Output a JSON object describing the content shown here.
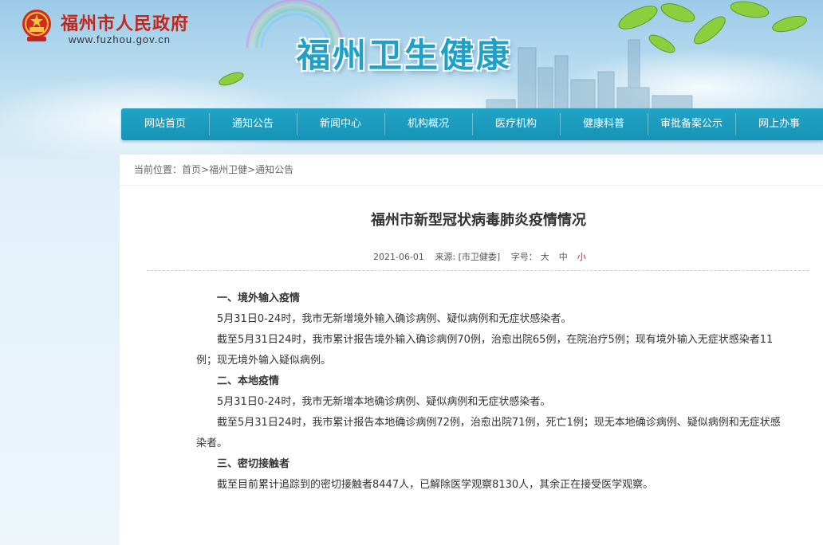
{
  "header": {
    "gov_name": "福州市人民政府",
    "gov_url": "www.fuzhou.gov.cn",
    "site_title": "福州卫生健康"
  },
  "nav": {
    "items": [
      "网站首页",
      "通知公告",
      "新闻中心",
      "机构概况",
      "医疗机构",
      "健康科普",
      "审批备案公示",
      "网上办事"
    ]
  },
  "breadcrumb": {
    "prefix": "当前位置：",
    "items": [
      "首页",
      "福州卫健",
      "通知公告"
    ],
    "separator": ">"
  },
  "article": {
    "title": "福州市新型冠状病毒肺炎疫情情况",
    "date": "2021-06-01",
    "source": "来源: [市卫健委]",
    "font_size_label": "字号：",
    "size_large": "大",
    "size_medium": "中",
    "size_small": "小",
    "paragraphs": [
      {
        "type": "heading",
        "text": "一、境外输入疫情"
      },
      {
        "type": "text",
        "text": "5月31日0-24时，我市无新增境外输入确诊病例、疑似病例和无症状感染者。"
      },
      {
        "type": "text",
        "text": "截至5月31日24时，我市累计报告境外输入确诊病例70例，治愈出院65例，在院治疗5例；现有境外输入无症状感染者11例；现无境外输入疑似病例。"
      },
      {
        "type": "heading",
        "text": "二、本地疫情"
      },
      {
        "type": "text",
        "text": "5月31日0-24时，我市无新增本地确诊病例、疑似病例和无症状感染者。"
      },
      {
        "type": "text",
        "text": "截至5月31日24时，我市累计报告本地确诊病例72例，治愈出院71例，死亡1例；现无本地确诊病例、疑似病例和无症状感染者。"
      },
      {
        "type": "heading",
        "text": "三、密切接触者"
      },
      {
        "type": "text",
        "text": "截至目前累计追踪到的密切接触者8447人，已解除医学观察8130人，其余正在接受医学观察。"
      }
    ]
  },
  "colors": {
    "nav_bg": "#1a9abd",
    "gov_red": "#c0281e",
    "title_blue": "#1fa0c7"
  }
}
